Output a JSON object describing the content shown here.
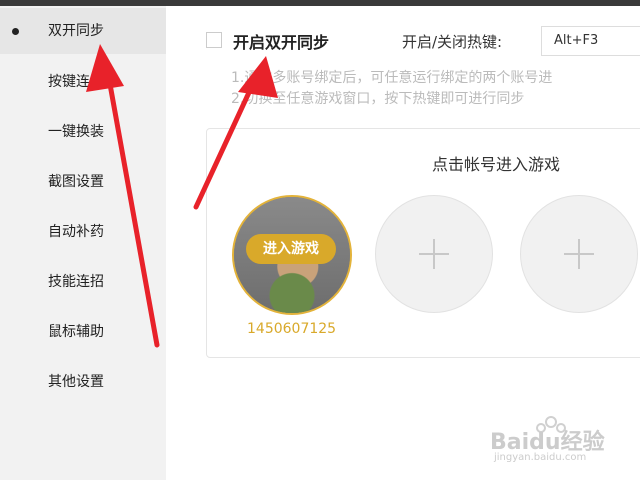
{
  "sidebar": {
    "items": [
      {
        "label": "双开同步"
      },
      {
        "label": "按键连发"
      },
      {
        "label": "一键换装"
      },
      {
        "label": "截图设置"
      },
      {
        "label": "自动补药"
      },
      {
        "label": "技能连招"
      },
      {
        "label": "鼠标辅助"
      },
      {
        "label": "其他设置"
      }
    ]
  },
  "main": {
    "sync_title": "开启双开同步",
    "hotkey_label": "开启/关闭热键:",
    "hotkey_value": "Alt+F3",
    "notes": [
      "1.通过多账号绑定后，可任意运行绑定的两个账号进",
      "2.切换至任意游戏窗口，按下热键即可进行同步"
    ],
    "panel": {
      "title": "点击帐号进入游戏",
      "enter_button": "进入游戏",
      "account_id": "1450607125"
    }
  },
  "watermark": {
    "brand": "Baidu经验",
    "url": "jingyan.baidu.com"
  },
  "colors": {
    "accent": "#d9a92a",
    "annotation_arrow": "#e8222a",
    "sidebar_bg": "#f2f2f2"
  }
}
